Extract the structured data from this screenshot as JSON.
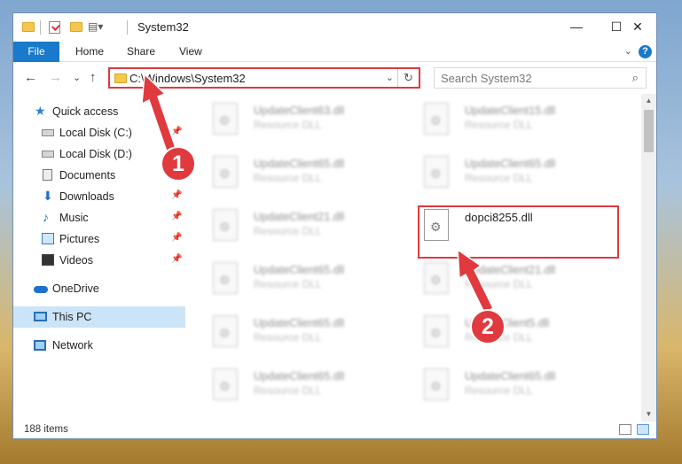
{
  "window": {
    "title": "System32",
    "minimize_glyph": "—",
    "maximize_glyph": "☐",
    "close_glyph": "✕"
  },
  "ribbon": {
    "file_tab": "File",
    "tabs": [
      "Home",
      "Share",
      "View"
    ],
    "help_glyph": "?",
    "expand_glyph": "⌄"
  },
  "navigation": {
    "back_glyph": "←",
    "forward_glyph": "→",
    "recent_glyph": "⌄",
    "up_glyph": "↑",
    "address_path": "C:\\Windows\\System32",
    "address_dropdown_glyph": "⌄",
    "refresh_glyph": "↻",
    "search_placeholder": "Search System32",
    "search_glyph": "⌕"
  },
  "sidebar": {
    "items": [
      {
        "label": "Quick access",
        "icon": "star-icon",
        "pinned": false
      },
      {
        "label": "Local Disk (C:)",
        "icon": "drive-icon",
        "pinned": true
      },
      {
        "label": "Local Disk (D:)",
        "icon": "drive-icon",
        "pinned": false
      },
      {
        "label": "Documents",
        "icon": "documents-icon",
        "pinned": true
      },
      {
        "label": "Downloads",
        "icon": "download-icon",
        "pinned": true
      },
      {
        "label": "Music",
        "icon": "music-icon",
        "pinned": true
      },
      {
        "label": "Pictures",
        "icon": "pictures-icon",
        "pinned": true
      },
      {
        "label": "Videos",
        "icon": "videos-icon",
        "pinned": true
      },
      {
        "label": "OneDrive",
        "icon": "onedrive-icon",
        "pinned": false
      },
      {
        "label": "This PC",
        "icon": "computer-icon",
        "pinned": false,
        "selected": true
      },
      {
        "label": "Network",
        "icon": "network-icon",
        "pinned": false
      }
    ],
    "pin_glyph": "📌"
  },
  "files": {
    "left_column": [
      {
        "name": "UpdateClient63.dll",
        "type": "Resource DLL"
      },
      {
        "name": "UpdateClient65.dll",
        "type": "Resource DLL"
      },
      {
        "name": "UpdateClient21.dll",
        "type": "Resource DLL"
      },
      {
        "name": "UpdateClient65.dll",
        "type": "Resource DLL"
      },
      {
        "name": "UpdateClient65.dll",
        "type": "Resource DLL"
      },
      {
        "name": "UpdateClient65.dll",
        "type": "Resource DLL"
      }
    ],
    "right_column": [
      {
        "name": "UpdateClient15.dll",
        "type": "Resource DLL"
      },
      {
        "name": "UpdateClient65.dll",
        "type": "Resource DLL"
      },
      {
        "name": "dopci8255.dll",
        "type": "",
        "highlighted": true
      },
      {
        "name": "UpdateClient21.dll",
        "type": "Resource DLL"
      },
      {
        "name": "UpdateClient5.dll",
        "type": "Resource DLL"
      },
      {
        "name": "UpdateClient65.dll",
        "type": "Resource DLL"
      }
    ]
  },
  "status": {
    "item_count": "188 items"
  },
  "annotations": {
    "step1": "1",
    "step2": "2",
    "color": "#e0393e"
  }
}
